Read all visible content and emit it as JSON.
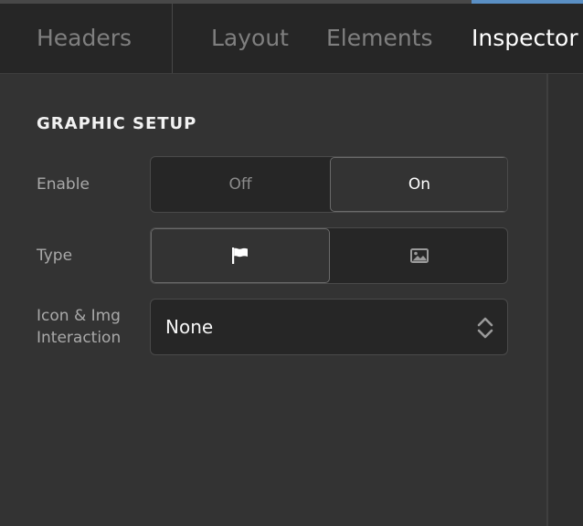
{
  "tabs": {
    "headers": "Headers",
    "layout": "Layout",
    "elements": "Elements",
    "inspector": "Inspector",
    "active": "inspector"
  },
  "section": {
    "title": "GRAPHIC SETUP"
  },
  "enable": {
    "label": "Enable",
    "off_label": "Off",
    "on_label": "On",
    "selected": "on"
  },
  "type": {
    "label": "Type",
    "options": [
      "flag-icon",
      "image-icon"
    ],
    "selected": "flag-icon"
  },
  "interaction": {
    "label": "Icon & Img Interaction",
    "value": "None"
  },
  "colors": {
    "background": "#2f2f2f",
    "tabbar": "#262626",
    "accent": "#5a8fc4",
    "text": "#ffffff",
    "muted_text": "#a9a9a9"
  }
}
